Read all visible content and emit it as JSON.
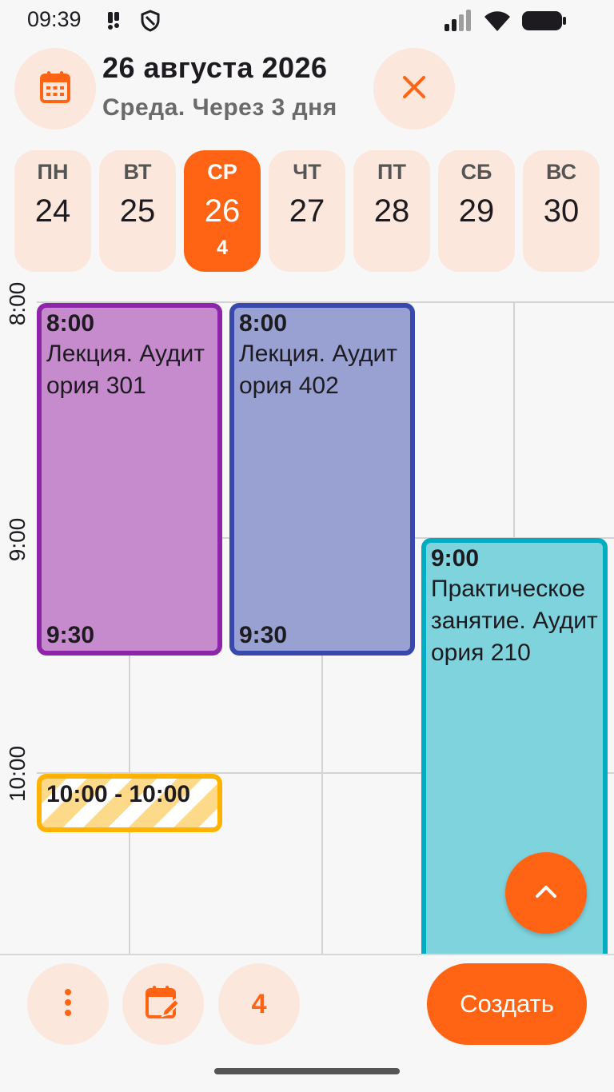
{
  "status_bar": {
    "time": "09:39",
    "icons": [
      "notification-icon",
      "shield-icon",
      "signal-icon",
      "wifi-icon",
      "battery-icon"
    ]
  },
  "header": {
    "title": "26 августа 2026",
    "subtitle": "Среда. Через 3 дня",
    "left_icon": "calendar-icon",
    "right_icon": "close-icon"
  },
  "week": {
    "days": [
      {
        "dow": "ПН",
        "num": "24"
      },
      {
        "dow": "ВТ",
        "num": "25"
      },
      {
        "dow": "СР",
        "num": "26",
        "count": "4",
        "selected": true
      },
      {
        "dow": "ЧТ",
        "num": "27"
      },
      {
        "dow": "ПТ",
        "num": "28"
      },
      {
        "dow": "СБ",
        "num": "29"
      },
      {
        "dow": "ВС",
        "num": "30"
      }
    ]
  },
  "timeline": {
    "hours": [
      "8:00",
      "9:00",
      "10:00"
    ],
    "events": [
      {
        "start": "8:00",
        "title": "Лекция. Аудитория 301",
        "end": "9:30",
        "fill": "#c68bcd",
        "border": "#8e24aa"
      },
      {
        "start": "8:00",
        "title": "Лекция. Аудитория 402",
        "end": "9:30",
        "fill": "#98a1d2",
        "border": "#3949ab"
      },
      {
        "start": "9:00",
        "title": "Практическое занятие. Аудитория 210",
        "end": "",
        "fill": "#7fd3dd",
        "border": "#00acc1"
      },
      {
        "start": "10:00 - 10:00",
        "title": "",
        "end": "",
        "fill": "striped",
        "border": "#ffb300"
      }
    ]
  },
  "bottom_bar": {
    "menu_icon": "more-vertical-icon",
    "edit_icon": "calendar-edit-icon",
    "count": "4",
    "create_label": "Создать"
  },
  "colors": {
    "accent": "#ff6414",
    "chip_bg": "#fbe7dc"
  }
}
